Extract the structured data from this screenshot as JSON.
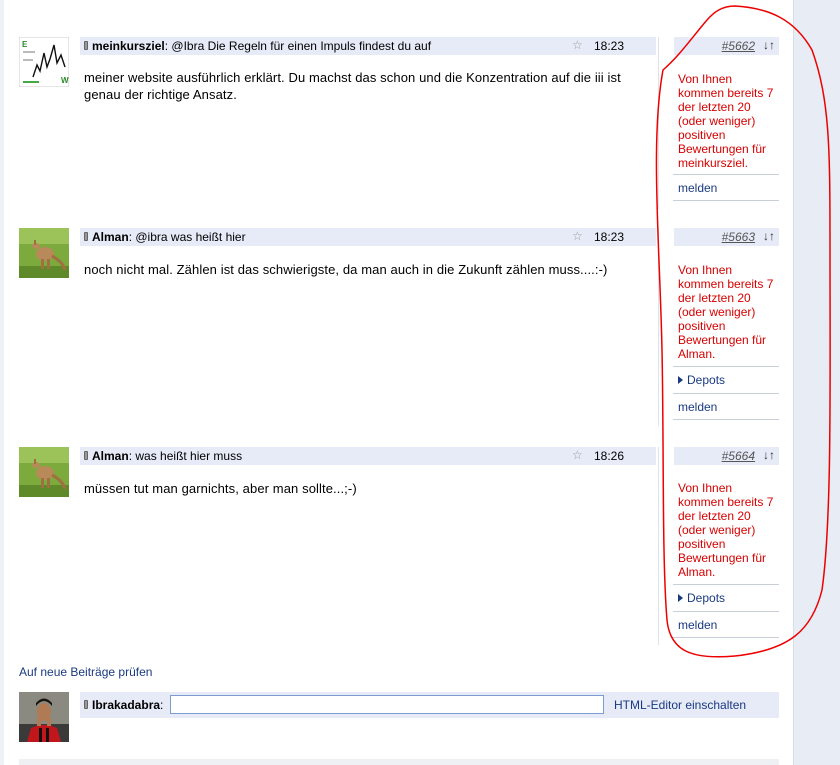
{
  "posts": [
    {
      "author": "meinkursziel",
      "subject": "@Ibra Die Regeln für einen Impuls findest du auf",
      "time": "18:23",
      "post_no": "#5662",
      "body": "meiner website ausführlich erklärt. Du machst das schon und die Konzentration auf die iii ist genau der richtige Ansatz.",
      "rating_note": "Von Ihnen kommen bereits 7 der letzten 20 (oder weniger) positiven Bewertungen für meinkursziel.",
      "links": [
        "melden"
      ],
      "avatar_icon": "chart-avatar"
    },
    {
      "author": "Alman",
      "subject": "@ibra was heißt hier",
      "time": "18:23",
      "post_no": "#5663",
      "body": "noch nicht mal. Zählen ist das schwierigste, da man auch in die Zukunft zählen muss....:-)",
      "rating_note": "Von Ihnen kommen bereits 7 der letzten 20 (oder weniger) positiven Bewertungen für Alman.",
      "links": [
        "Depots",
        "melden"
      ],
      "avatar_icon": "kangaroo-avatar"
    },
    {
      "author": "Alman",
      "subject": "was heißt hier muss",
      "time": "18:26",
      "post_no": "#5664",
      "body": "müssen tut man garnichts, aber man sollte...;-)",
      "rating_note": "Von Ihnen kommen bereits 7 der letzten 20 (oder weniger) positiven Bewertungen für Alman.",
      "links": [
        "Depots",
        "melden"
      ],
      "avatar_icon": "kangaroo-avatar"
    }
  ],
  "ui": {
    "sep": ":",
    "arrows": "↓↑",
    "star": "☆"
  },
  "footer": {
    "check_new_link": "Auf neue Beiträge prüfen",
    "reply_user": "Ibrakadabra",
    "reply_sep": ":",
    "reply_value": "",
    "html_editor_link": "HTML-Editor einschalten",
    "reply_avatar_icon": "soccer-player-avatar"
  },
  "colors": {
    "header_bg": "#e6ebf7",
    "note_red": "#d80000",
    "link_blue": "#1a3a80",
    "annotation_red": "#ee0000"
  }
}
